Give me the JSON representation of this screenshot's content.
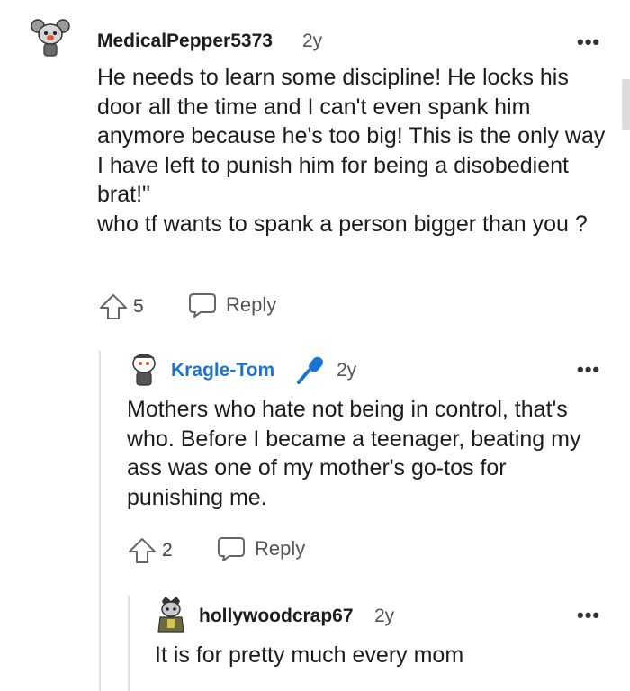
{
  "comments": [
    {
      "username": "MedicalPepper5373",
      "age": "2y",
      "body": "He needs to learn some discipline! He locks his door all the time and I can't even spank him anymore because he's too big! This is the only way I have left to punish him for being a disobedient brat!\"\nwho tf wants to spank a person bigger than you ?",
      "votes": "5",
      "reply_label": "Reply"
    },
    {
      "username": "Kragle-Tom",
      "age": "2y",
      "body": "Mothers who hate not being in control, that's who. Before I became a teenager, beating my ass was one of my mother's go-tos for punishing me.",
      "votes": "2",
      "reply_label": "Reply",
      "flair_icon": "microphone-icon",
      "username_color": "#1a75d1"
    },
    {
      "username": "hollywoodcrap67",
      "age": "2y",
      "body": "It is for pretty much every mom"
    }
  ],
  "more_label": "•••"
}
